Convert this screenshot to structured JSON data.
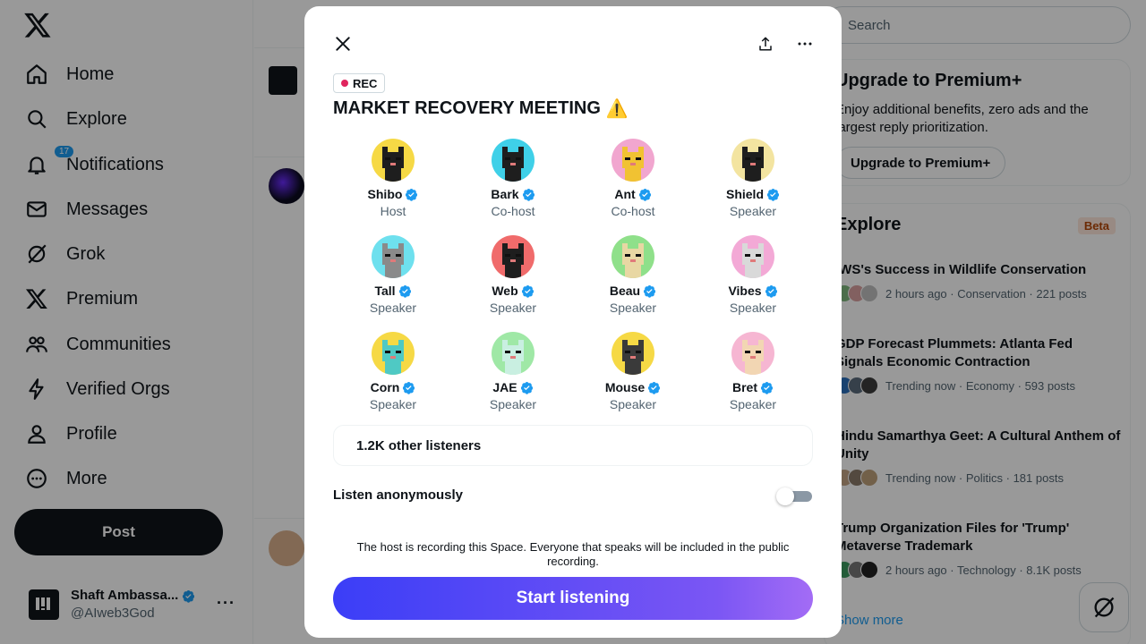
{
  "leftnav": {
    "items": [
      {
        "label": "Home",
        "icon": "home-icon"
      },
      {
        "label": "Explore",
        "icon": "search-icon"
      },
      {
        "label": "Notifications",
        "icon": "bell-icon",
        "badge": "17"
      },
      {
        "label": "Messages",
        "icon": "mail-icon"
      },
      {
        "label": "Grok",
        "icon": "grok-icon"
      },
      {
        "label": "Premium",
        "icon": "x-logo-icon"
      },
      {
        "label": "Communities",
        "icon": "people-icon"
      },
      {
        "label": "Verified Orgs",
        "icon": "lightning-icon"
      },
      {
        "label": "Profile",
        "icon": "person-icon"
      },
      {
        "label": "More",
        "icon": "more-circle-icon"
      }
    ],
    "post_label": "Post",
    "account": {
      "name": "Shaft Ambassa...",
      "handle": "@AIweb3God"
    }
  },
  "rightcol": {
    "search_placeholder": "Search",
    "premium": {
      "title": "Upgrade to Premium+",
      "desc": "Enjoy additional benefits, zero ads and the largest reply prioritization.",
      "button": "Upgrade to Premium+"
    },
    "explore": {
      "title": "Explore",
      "badge": "Beta",
      "trends": [
        {
          "title": "IWS's Success in Wildlife Conservation",
          "meta": "2 hours ago · Conservation · 221 posts"
        },
        {
          "title": "GDP Forecast Plummets: Atlanta Fed Signals Economic Contraction",
          "meta": "Trending now · Economy · 593 posts"
        },
        {
          "title": "Hindu Samarthya Geet: A Cultural Anthem of Unity",
          "meta": "Trending now · Politics · 181 posts"
        },
        {
          "title": "Trump Organization Files for 'Trump' Metaverse Trademark",
          "meta": "2 hours ago · Technology · 8.1K posts"
        }
      ],
      "show_more": "Show more"
    }
  },
  "modal": {
    "rec_label": "REC",
    "title": "MARKET RECOVERY MEETING",
    "title_emoji": "⚠️",
    "participants": [
      {
        "name": "Shibo",
        "role": "Host",
        "bg": "#f6d945",
        "fg": "#1e1e1e"
      },
      {
        "name": "Bark",
        "role": "Co-host",
        "bg": "#3fd0e8",
        "fg": "#1e1e1e"
      },
      {
        "name": "Ant",
        "role": "Co-host",
        "bg": "#f1a6cf",
        "fg": "#f1c232"
      },
      {
        "name": "Shield",
        "role": "Speaker",
        "bg": "#f3e4a0",
        "fg": "#1e1e1e"
      },
      {
        "name": "Tall",
        "role": "Speaker",
        "bg": "#6ee0ee",
        "fg": "#8a8a8a"
      },
      {
        "name": "Web",
        "role": "Speaker",
        "bg": "#f06b6b",
        "fg": "#1e1e1e"
      },
      {
        "name": "Beau",
        "role": "Speaker",
        "bg": "#8fe08a",
        "fg": "#e8d7a3"
      },
      {
        "name": "Vibes",
        "role": "Speaker",
        "bg": "#f3a9d6",
        "fg": "#d9d9d9"
      },
      {
        "name": "Corn",
        "role": "Speaker",
        "bg": "#f6d945",
        "fg": "#4fc9c4"
      },
      {
        "name": "JAE",
        "role": "Speaker",
        "bg": "#9fe8a6",
        "fg": "#c9efe1"
      },
      {
        "name": "Mouse",
        "role": "Speaker",
        "bg": "#f6d945",
        "fg": "#3a3a3a"
      },
      {
        "name": "Bret",
        "role": "Speaker",
        "bg": "#f6b6d2",
        "fg": "#f2d6b3"
      }
    ],
    "listeners": "1.2K other listeners",
    "anon_label": "Listen anonymously",
    "anon_enabled": false,
    "rec_note": "The host is recording this Space. Everyone that speaks will be included in the public recording.",
    "start_label": "Start listening"
  }
}
